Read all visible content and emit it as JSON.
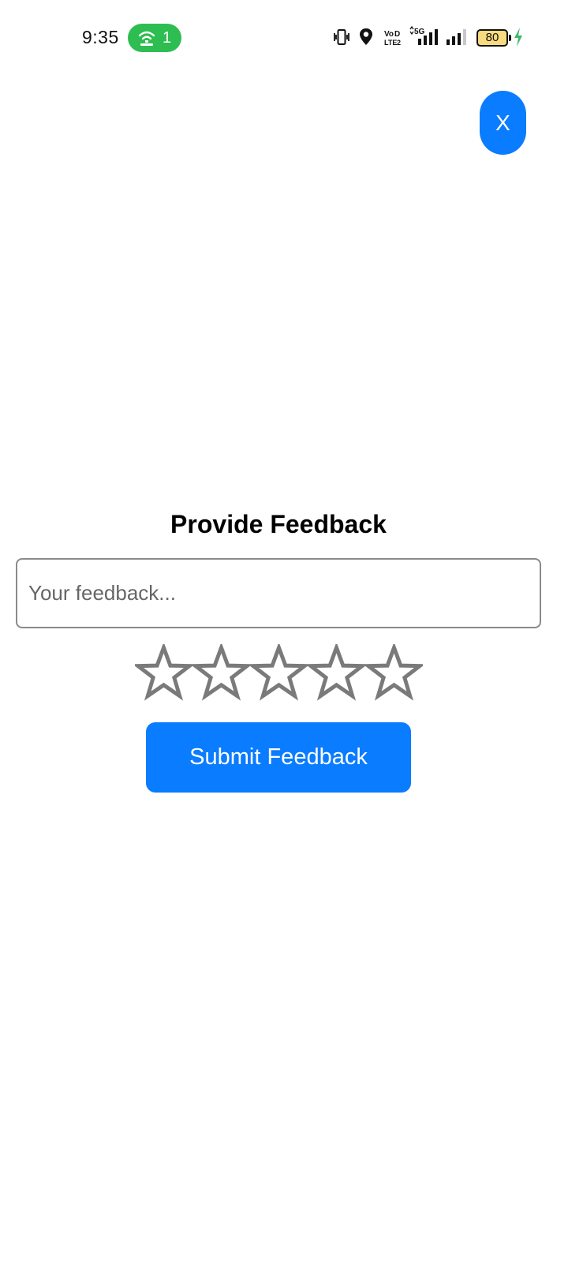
{
  "status_bar": {
    "time": "9:35",
    "hotspot_count": "1",
    "battery_level": "80",
    "icons": [
      "hotspot-icon",
      "vibrate-icon",
      "location-icon",
      "volte-icon",
      "5g-signal-icon",
      "signal-icon",
      "battery-icon",
      "charging-icon"
    ],
    "colors": {
      "hotspot_pill": "#2dbd51",
      "battery_fill": "#f7db7e",
      "charging": "#3fb86a"
    }
  },
  "close_button": {
    "label": "X"
  },
  "feedback": {
    "title": "Provide Feedback",
    "input": {
      "value": "",
      "placeholder": "Your feedback..."
    },
    "rating": {
      "max": 5,
      "selected": 0,
      "icon": "star-outline-icon"
    },
    "submit_label": "Submit Feedback"
  },
  "colors": {
    "accent": "#0a7cff",
    "star_outline": "#7a7a7a"
  }
}
